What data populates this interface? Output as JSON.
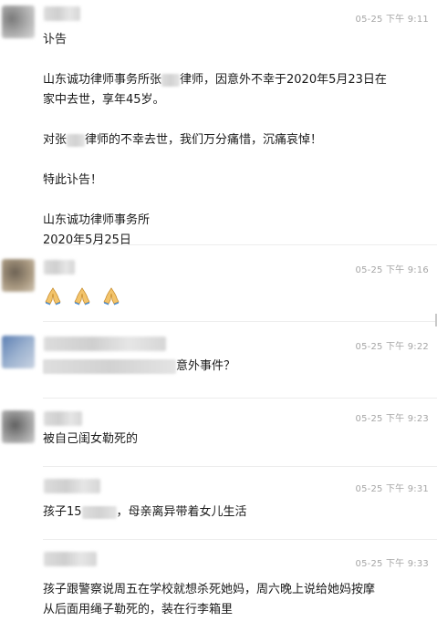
{
  "messages": [
    {
      "time": "05-25 下午 9:11",
      "lines": [
        "讣告",
        "",
        "山东诚功律师事务所张",
        "律师，因意外不幸于2020年5月23日在",
        "家中去世，享年45岁。",
        "",
        "对张",
        "律师的不幸去世，我们万分痛惜，沉痛哀悼！",
        "",
        "特此讣告！",
        "",
        "山东诚功律师事务所",
        "2020年5月25日"
      ]
    },
    {
      "time": "05-25 下午 9:16",
      "emoji_names": [
        "folded-hands-icon",
        "folded-hands-icon",
        "folded-hands-icon"
      ]
    },
    {
      "time": "05-25 下午 9:22",
      "text_after_redaction": "意外事件？"
    },
    {
      "time": "05-25 下午 9:23",
      "text": "被自己闺女勒死的"
    },
    {
      "time": "05-25 下午 9:31",
      "text_prefix": "孩子15",
      "text_suffix": "，母亲离异带着女儿生活"
    },
    {
      "time": "05-25 下午 9:33",
      "line1": "孩子跟警察说周五在学校就想杀死她妈，周六晚上说给她妈按摩",
      "line2": "从后面用绳子勒死的，装在行李箱里"
    }
  ]
}
